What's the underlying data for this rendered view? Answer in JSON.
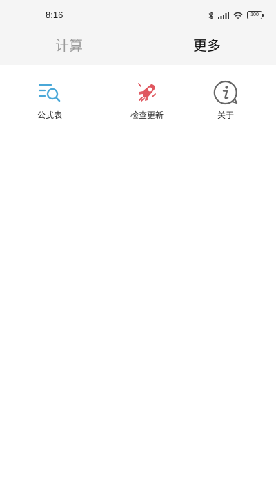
{
  "status": {
    "time": "8:16",
    "battery": "100",
    "icons": [
      "bluetooth-icon",
      "signal-icon",
      "wifi-icon",
      "battery-icon"
    ]
  },
  "tabs": [
    {
      "label": "计算",
      "active": false
    },
    {
      "label": "更多",
      "active": true
    }
  ],
  "tools": [
    {
      "label": "公式表",
      "icon": "formula-list-search-icon",
      "color": "#4aa8d8"
    },
    {
      "label": "检查更新",
      "icon": "rocket-icon",
      "color": "#e0575f"
    },
    {
      "label": "关于",
      "icon": "info-icon",
      "color": "#666666"
    }
  ]
}
